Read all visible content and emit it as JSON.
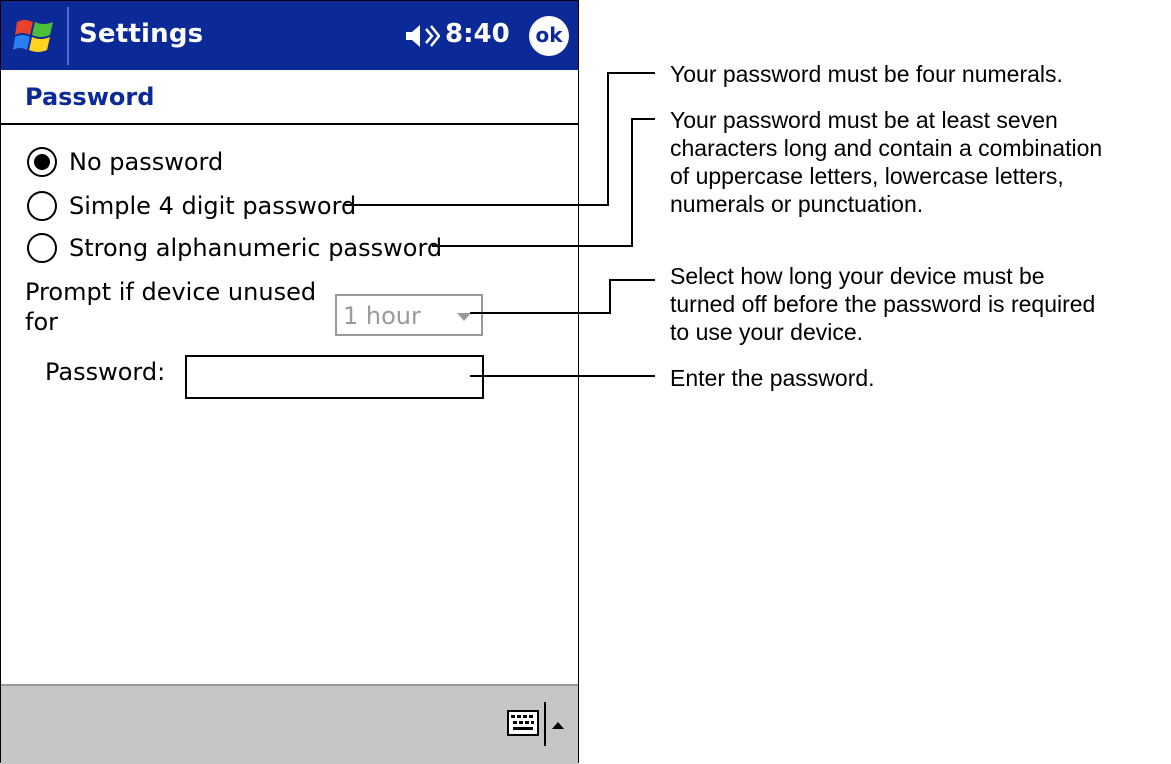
{
  "titlebar": {
    "title": "Settings",
    "time": "8:40",
    "ok_label": "ok",
    "start_icon": "windows-flag-icon",
    "volume_icon": "speaker-icon"
  },
  "page": {
    "title": "Password"
  },
  "options": [
    {
      "label": "No password",
      "selected": true
    },
    {
      "label": "Simple 4 digit password",
      "selected": false
    },
    {
      "label": "Strong alphanumeric password",
      "selected": false
    }
  ],
  "prompt": {
    "label_line1": "Prompt if device unused",
    "label_line2": "for",
    "value": "1 hour"
  },
  "password": {
    "label": "Password:",
    "value": ""
  },
  "bottombar": {
    "keyboard_icon": "keyboard-icon",
    "sip_arrow_icon": "up-arrow-icon"
  },
  "callouts": [
    {
      "lines": [
        "Your password must be four numerals."
      ]
    },
    {
      "lines": [
        "Your password must be at least seven",
        "characters long and contain a combination",
        "of uppercase letters, lowercase letters,",
        "numerals or punctuation."
      ]
    },
    {
      "lines": [
        "Select how long your device must be",
        "turned off before the password is required",
        "to use your device."
      ]
    },
    {
      "lines": [
        "Enter the password."
      ]
    }
  ],
  "colors": {
    "titlebar": "#0b2a97",
    "bottombar": "#c6c6c6"
  }
}
